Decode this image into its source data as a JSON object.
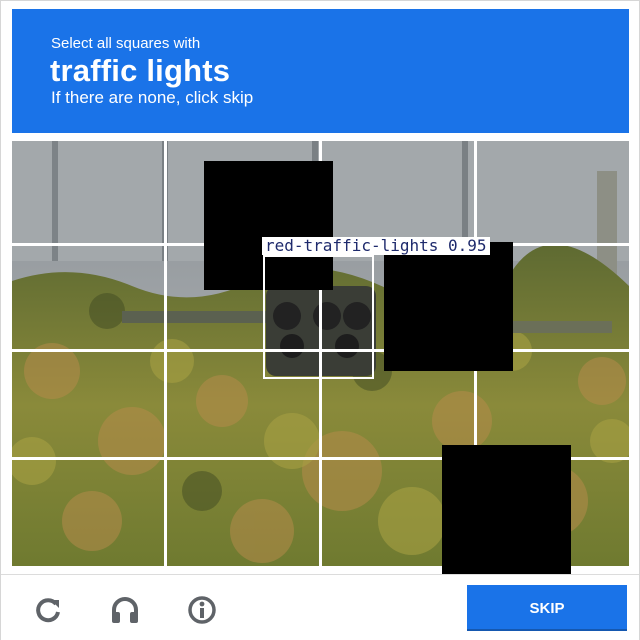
{
  "header": {
    "line1": "Select all squares with",
    "target": "traffic lights",
    "line3": "If there are none, click skip",
    "background": "#1a73e8"
  },
  "grid": {
    "rows": 4,
    "cols": 4
  },
  "detection": {
    "label": "red-traffic-lights 0.95",
    "box_color": "#ffffff",
    "label_color": "#1e2a6c"
  },
  "footer": {
    "reload_icon": "reload-icon",
    "audio_icon": "headphones-icon",
    "info_icon": "info-icon",
    "skip_label": "SKIP",
    "accent": "#1a73e8"
  }
}
